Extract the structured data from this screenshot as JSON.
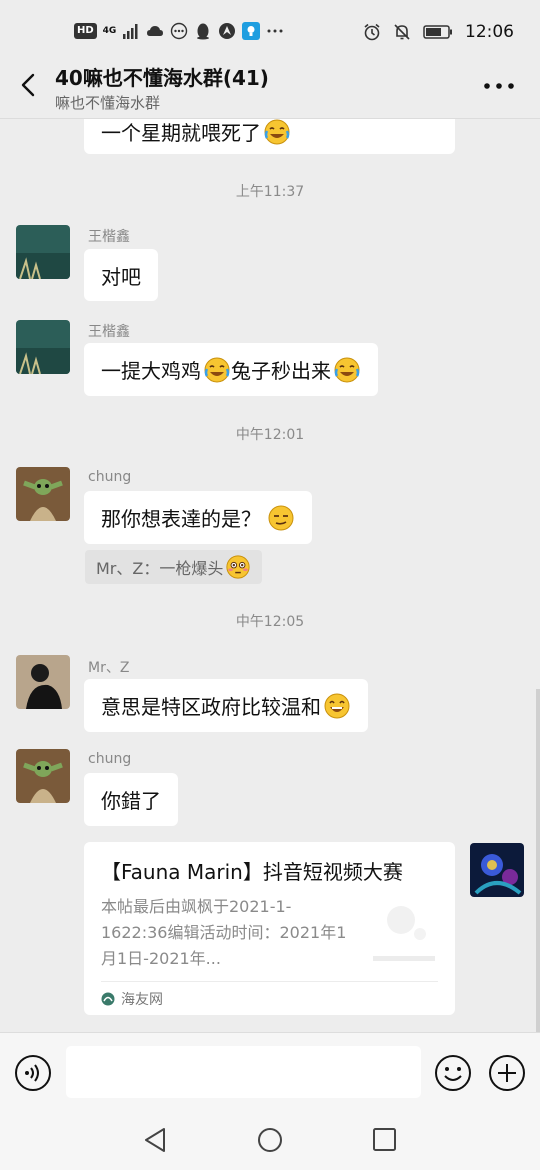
{
  "status_bar": {
    "hd": "HD",
    "network": "4G",
    "time": "12:06",
    "icons": [
      "hd-icon",
      "signal-icon",
      "cloud-icon",
      "dots-icon",
      "qq-penguin-icon",
      "navigation-icon",
      "lightbulb-icon",
      "more-dots-icon",
      "alarm-icon",
      "mute-bell-icon",
      "battery-icon"
    ]
  },
  "header": {
    "title": "40嘛也不懂海水群(41)",
    "subtitle": "嘛也不懂海水群",
    "back_icon": "chevron-left-icon",
    "more_icon": "more-icon"
  },
  "messages": [
    {
      "type": "text",
      "side": "left",
      "text": "一个星期就喂死了",
      "emoji": "crying-laughing-emoji"
    },
    {
      "type": "time",
      "text": "上午11:37"
    },
    {
      "type": "text",
      "side": "left",
      "sender": "王楷鑫",
      "text": "对吧"
    },
    {
      "type": "text",
      "side": "left",
      "sender": "王楷鑫",
      "text": "一提大鸡鸡",
      "text2": "兔子秒出来",
      "emoji": "crying-laughing-emoji"
    },
    {
      "type": "time",
      "text": "中午12:01"
    },
    {
      "type": "text",
      "side": "left",
      "sender": "chung",
      "text": "那你想表達的是？",
      "emoji": "smirk-emoji"
    },
    {
      "type": "quote",
      "text": "Mr、Z：一枪爆头",
      "emoji": "flushed-emoji"
    },
    {
      "type": "time",
      "text": "中午12:05"
    },
    {
      "type": "text",
      "side": "left",
      "sender": "Mr、Z",
      "text": "意思是特区政府比较温和",
      "emoji": "laughing-emoji"
    },
    {
      "type": "text",
      "side": "left",
      "sender": "chung",
      "text": "你錯了"
    },
    {
      "type": "link_card",
      "side": "right",
      "title": "【Fauna Marin】抖音短视频大赛",
      "desc": "本帖最后由飒枫于2021-1-1622:36编辑活动时间：2021年1月1日-2021年...",
      "source": "海友网"
    }
  ],
  "input_bar": {
    "placeholder": "",
    "voice_icon": "voice-icon",
    "emoji_icon": "emoji-icon",
    "plus_icon": "plus-icon"
  },
  "nav_bar": {
    "icons": [
      "back-triangle-icon",
      "home-circle-icon",
      "recent-square-icon"
    ]
  }
}
